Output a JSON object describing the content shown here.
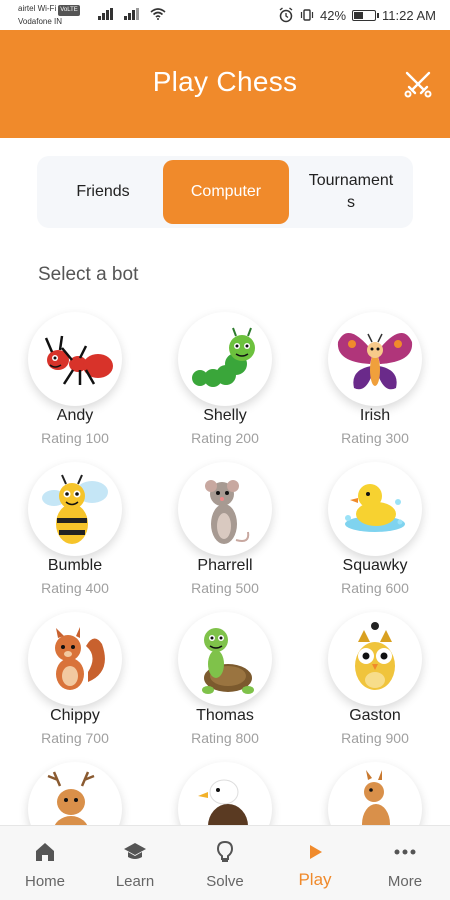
{
  "status_bar": {
    "carrier_line1": "airtel Wi-Fi",
    "carrier_badge": "VoLTE",
    "carrier_line2": "Vodafone IN",
    "battery_text": "42%",
    "battery_level": 0.42,
    "time": "11:22 AM"
  },
  "header": {
    "title": "Play Chess",
    "icon": "crossed-swords-icon"
  },
  "tabs": {
    "friends": "Friends",
    "computer": "Computer",
    "tournaments": "Tournament\ns",
    "active": "computer"
  },
  "section_label": "Select a bot",
  "bots": [
    {
      "name": "Andy",
      "rating": "Rating 100",
      "icon": "ant-icon"
    },
    {
      "name": "Shelly",
      "rating": "Rating 200",
      "icon": "caterpillar-icon"
    },
    {
      "name": "Irish",
      "rating": "Rating 300",
      "icon": "butterfly-icon"
    },
    {
      "name": "Bumble",
      "rating": "Rating 400",
      "icon": "bee-icon"
    },
    {
      "name": "Pharrell",
      "rating": "Rating 500",
      "icon": "mouse-icon"
    },
    {
      "name": "Squawky",
      "rating": "Rating 600",
      "icon": "duck-icon"
    },
    {
      "name": "Chippy",
      "rating": "Rating 700",
      "icon": "squirrel-icon"
    },
    {
      "name": "Thomas",
      "rating": "Rating 800",
      "icon": "turtle-icon"
    },
    {
      "name": "Gaston",
      "rating": "Rating 900",
      "icon": "owl-icon"
    },
    {
      "icon": "deer-icon"
    },
    {
      "icon": "eagle-icon"
    },
    {
      "icon": "kangaroo-icon"
    }
  ],
  "bottom_nav": [
    {
      "label": "Home",
      "icon": "home-icon"
    },
    {
      "label": "Learn",
      "icon": "graduation-cap-icon"
    },
    {
      "label": "Solve",
      "icon": "lightbulb-icon"
    },
    {
      "label": "Play",
      "icon": "play-icon",
      "active": true
    },
    {
      "label": "More",
      "icon": "more-dots-icon"
    }
  ],
  "colors": {
    "accent": "#f08a2b",
    "rating_text": "#a0a0a0"
  }
}
